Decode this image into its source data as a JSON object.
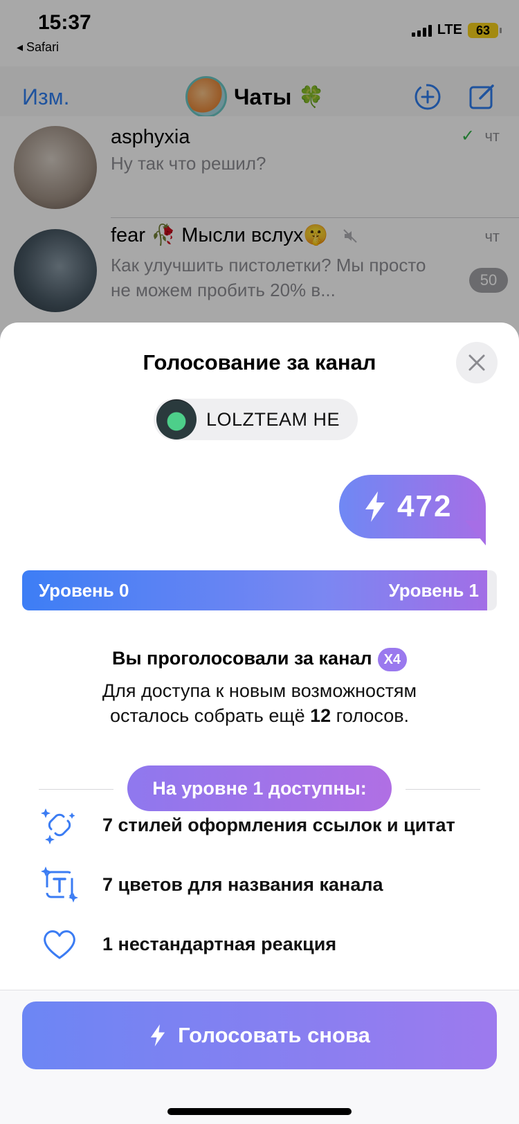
{
  "status_bar": {
    "time": "15:37",
    "back_app": "◂ Safari",
    "network": "LTE",
    "battery": "63"
  },
  "nav": {
    "edit_label": "Изм.",
    "title": "Чаты",
    "title_emoji": "🍀"
  },
  "chats": [
    {
      "name": "asphyxia",
      "message": "Ну так что решил?",
      "time": "чт",
      "read_check": "✓"
    },
    {
      "name": "fear 🥀 Мысли вслух🤫",
      "message": "Как улучшить пистолетки? Мы просто не можем пробить 20% в...",
      "time": "чт",
      "unread": "50",
      "muted": true
    }
  ],
  "sheet": {
    "title": "Голосование за канал",
    "channel_name": "LOLZTEAM HE",
    "boost_count": "472",
    "level_current": "Уровень 0",
    "level_next": "Уровень 1",
    "level_progress": 0.98,
    "voted_text": "Вы проголосовали за канал",
    "multiplier": "X4",
    "info_line1": "Для доступа к новым возможностям",
    "info_line2_prefix": "осталось собрать ещё ",
    "info_line2_count": "12",
    "info_line2_suffix": " голосов.",
    "level_unlocks_title": "На уровне 1 доступны:",
    "features": [
      {
        "icon": "link-sparkle-icon",
        "label": "7 стилей оформления ссылок и цитат"
      },
      {
        "icon": "text-color-sparkle-icon",
        "label": "7 цветов для названия канала"
      },
      {
        "icon": "heart-icon",
        "label": "1 нестандартная реакция"
      }
    ],
    "vote_button": "Голосовать снова"
  },
  "colors": {
    "accent": "#2f7ff0",
    "gradient_start": "#3d7ef5",
    "gradient_end": "#a66ee6",
    "check_green": "#32b44a"
  }
}
